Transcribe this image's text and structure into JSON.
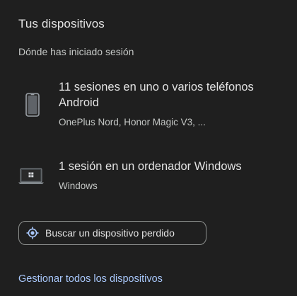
{
  "section": {
    "title": "Tus dispositivos",
    "subtitle": "Dónde has iniciado sesión"
  },
  "devices": [
    {
      "icon": "phone-icon",
      "primary": "11 sesiones en uno o varios teléfonos Android",
      "secondary": "OnePlus Nord, Honor Magic V3, ..."
    },
    {
      "icon": "laptop-windows-icon",
      "primary": "1 sesión en un ordenador Windows",
      "secondary": "Windows"
    }
  ],
  "find_device": {
    "icon": "location-target-icon",
    "label": "Buscar un dispositivo perdido"
  },
  "manage_link": {
    "label": "Gestionar todos los dispositivos"
  },
  "colors": {
    "background": "#1f1f1f",
    "text_primary": "#e3e3e3",
    "text_secondary": "#c4c7c5",
    "link": "#a8c7fa",
    "accent_icon": "#a8c7fa",
    "button_border": "#8e918f"
  }
}
